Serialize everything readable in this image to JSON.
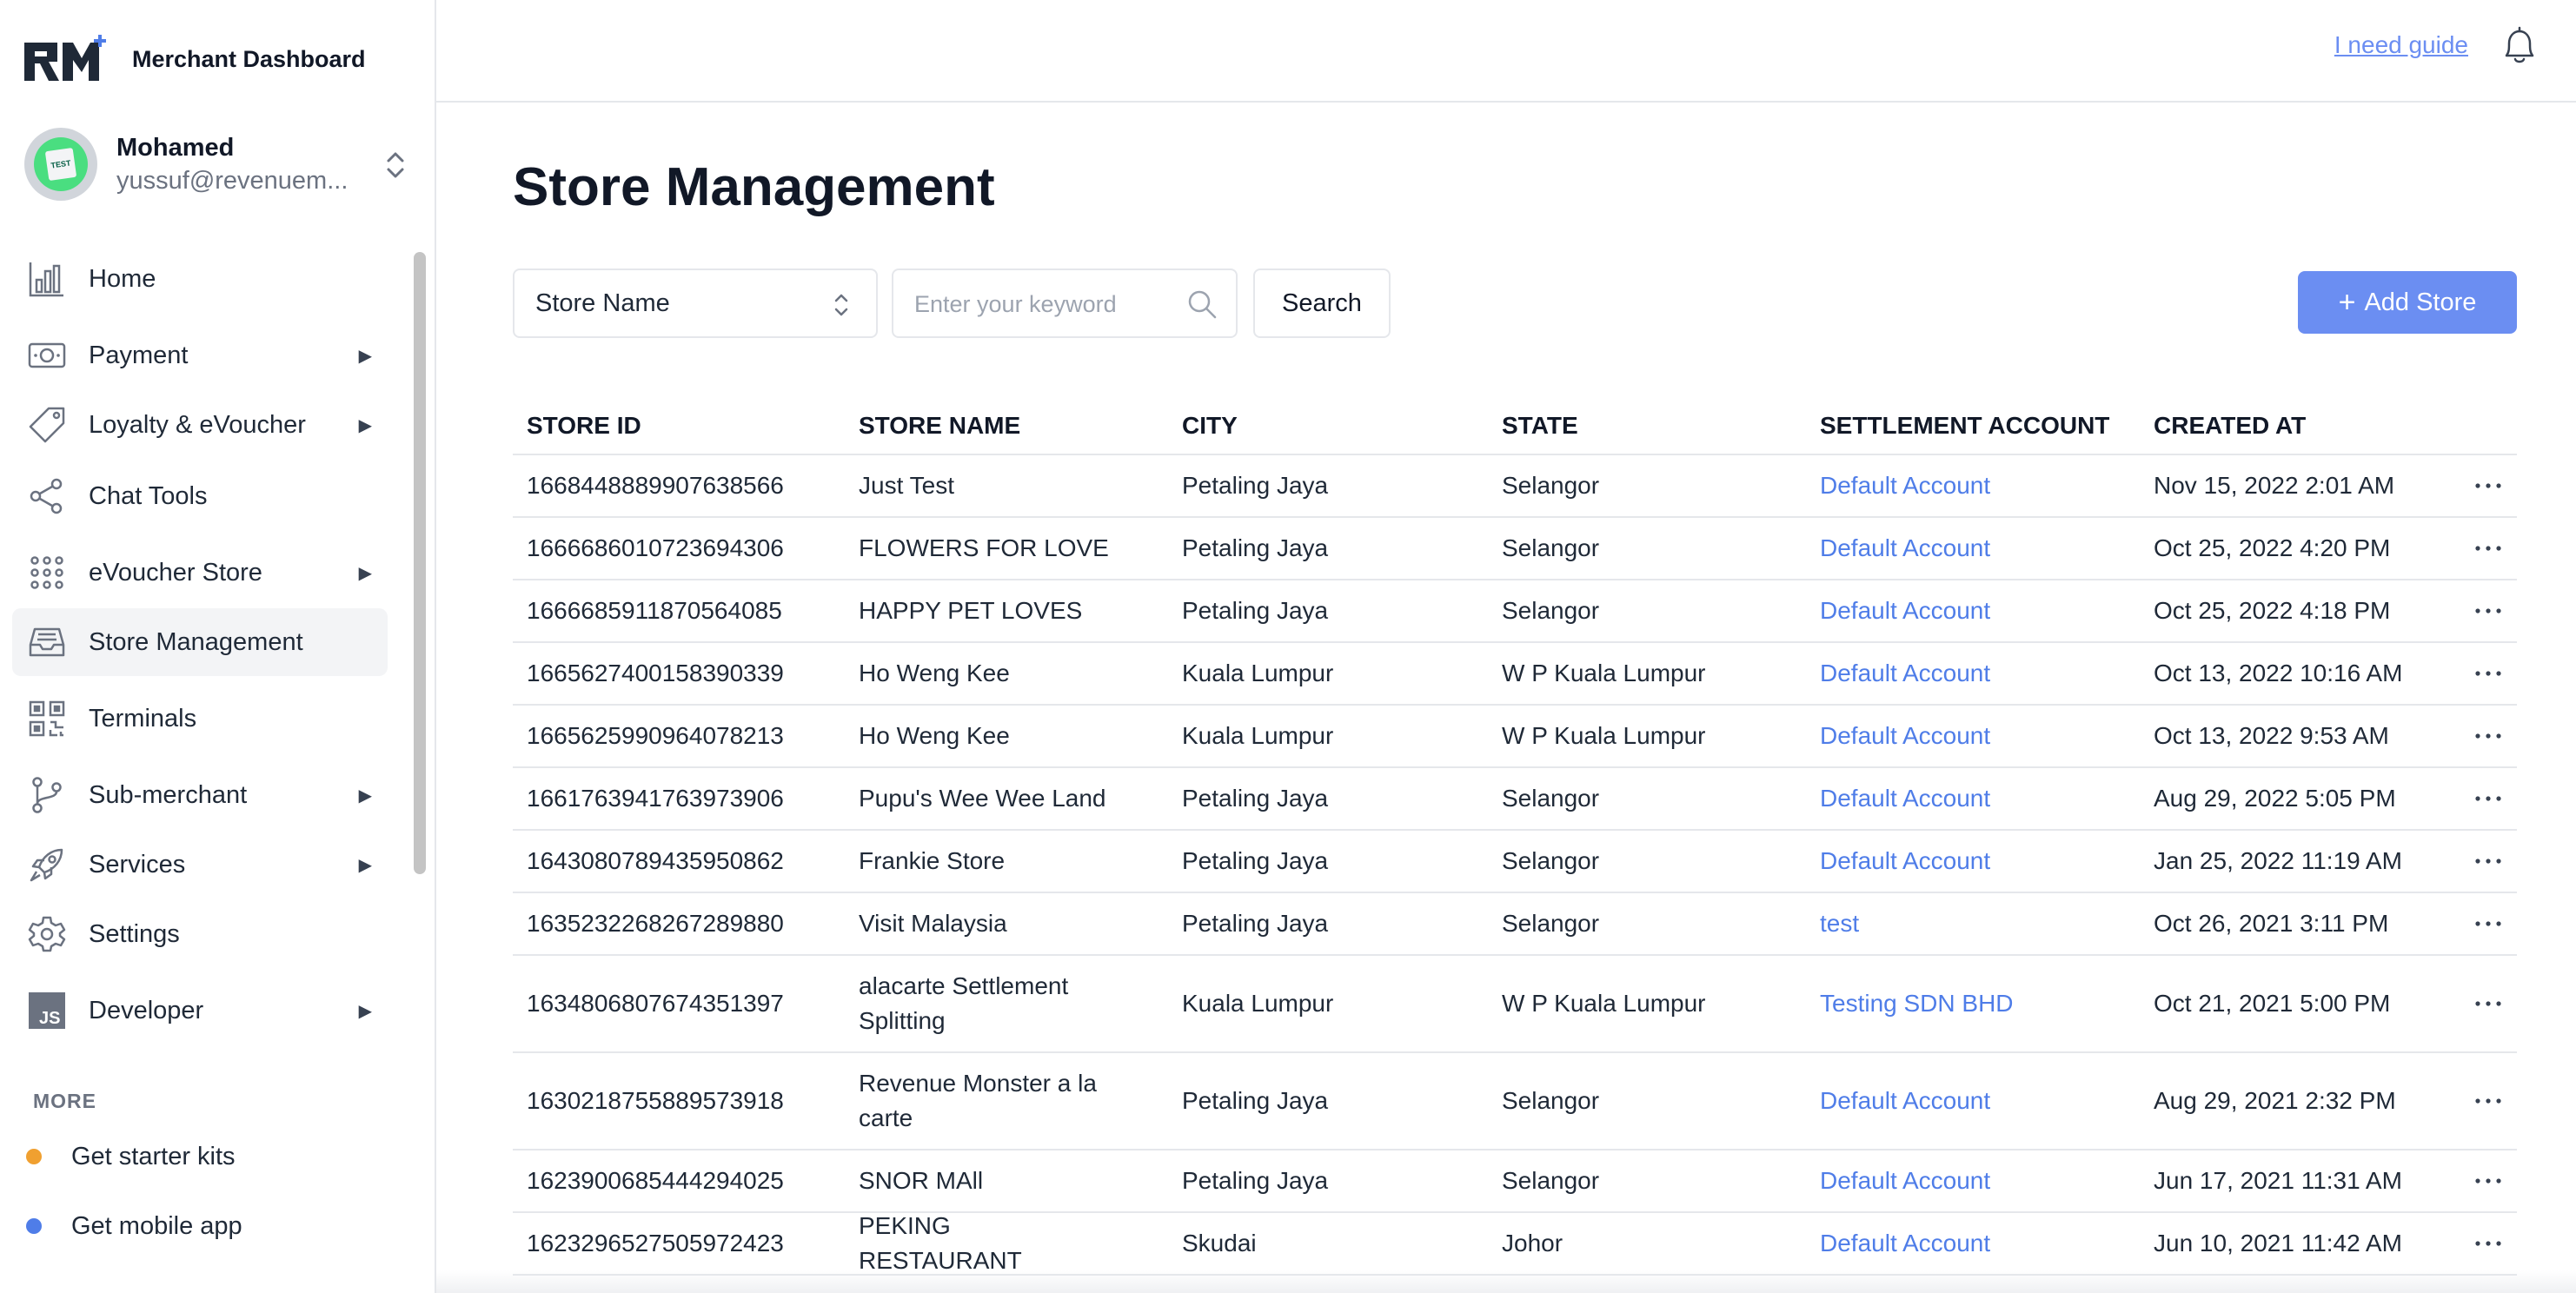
{
  "brand": {
    "title": "Merchant Dashboard",
    "logo_text": "RM"
  },
  "account": {
    "name": "Mohamed",
    "email": "yussuf@revenuem...",
    "avatar_text": "TEST"
  },
  "nav": [
    {
      "label": "Home",
      "icon": "bar-chart-icon",
      "has_submenu": false,
      "active": false
    },
    {
      "label": "Payment",
      "icon": "cash-icon",
      "has_submenu": true,
      "active": false
    },
    {
      "label": "Loyalty & eVoucher",
      "icon": "tag-icon",
      "has_submenu": true,
      "active": false
    },
    {
      "label": "Chat Tools",
      "icon": "share-icon",
      "has_submenu": false,
      "active": false
    },
    {
      "label": "eVoucher Store",
      "icon": "grid-dots-icon",
      "has_submenu": true,
      "active": false
    },
    {
      "label": "Store Management",
      "icon": "inbox-icon",
      "has_submenu": false,
      "active": true
    },
    {
      "label": "Terminals",
      "icon": "qr-code-icon",
      "has_submenu": false,
      "active": false
    },
    {
      "label": "Sub-merchant",
      "icon": "branch-icon",
      "has_submenu": true,
      "active": false
    },
    {
      "label": "Services",
      "icon": "rocket-icon",
      "has_submenu": true,
      "active": false
    },
    {
      "label": "Settings",
      "icon": "gear-icon",
      "has_submenu": false,
      "active": false
    },
    {
      "label": "Developer",
      "icon": "js-icon",
      "has_submenu": true,
      "active": false
    }
  ],
  "more": {
    "title": "MORE",
    "items": [
      {
        "label": "Get starter kits",
        "color": "#f0a030"
      },
      {
        "label": "Get mobile app",
        "color": "#4f7de8"
      }
    ]
  },
  "topbar": {
    "guide_link": "I need guide",
    "icon": "bell-icon"
  },
  "page": {
    "title": "Store Management"
  },
  "filters": {
    "select_value": "Store Name",
    "search_placeholder": "Enter your keyword",
    "search_button": "Search",
    "add_button": "Add Store"
  },
  "colors": {
    "accent": "#6b8ef2",
    "link": "#4f7de8",
    "active_nav_bg": "#f3f4f6"
  },
  "table": {
    "columns": [
      "STORE ID",
      "STORE NAME",
      "CITY",
      "STATE",
      "SETTLEMENT ACCOUNT",
      "CREATED AT"
    ],
    "rows": [
      {
        "id": "1668448889907638566",
        "name": "Just Test",
        "city": "Petaling Jaya",
        "state": "Selangor",
        "settlement": "Default Account",
        "created": "Nov 15, 2022 2:01 AM"
      },
      {
        "id": "1666686010723694306",
        "name": "FLOWERS FOR LOVE",
        "city": "Petaling Jaya",
        "state": "Selangor",
        "settlement": "Default Account",
        "created": "Oct 25, 2022 4:20 PM"
      },
      {
        "id": "1666685911870564085",
        "name": "HAPPY PET LOVES",
        "city": "Petaling Jaya",
        "state": "Selangor",
        "settlement": "Default Account",
        "created": "Oct 25, 2022 4:18 PM"
      },
      {
        "id": "1665627400158390339",
        "name": "Ho Weng Kee",
        "city": "Kuala Lumpur",
        "state": "W P Kuala Lumpur",
        "settlement": "Default Account",
        "created": "Oct 13, 2022 10:16 AM"
      },
      {
        "id": "1665625990964078213",
        "name": "Ho Weng Kee",
        "city": "Kuala Lumpur",
        "state": "W P Kuala Lumpur",
        "settlement": "Default Account",
        "created": "Oct 13, 2022 9:53 AM"
      },
      {
        "id": "1661763941763973906",
        "name": "Pupu's Wee Wee Land",
        "city": "Petaling Jaya",
        "state": "Selangor",
        "settlement": "Default Account",
        "created": "Aug 29, 2022 5:05 PM"
      },
      {
        "id": "1643080789435950862",
        "name": "Frankie Store",
        "city": "Petaling Jaya",
        "state": "Selangor",
        "settlement": "Default Account",
        "created": "Jan 25, 2022 11:19 AM"
      },
      {
        "id": "1635232268267289880",
        "name": "Visit Malaysia",
        "city": "Petaling Jaya",
        "state": "Selangor",
        "settlement": "test",
        "created": "Oct 26, 2021 3:11 PM"
      },
      {
        "id": "1634806807674351397",
        "name": "alacarte Settlement Splitting",
        "city": "Kuala Lumpur",
        "state": "W P Kuala Lumpur",
        "settlement": "Testing SDN BHD",
        "created": "Oct 21, 2021 5:00 PM"
      },
      {
        "id": "1630218755889573918",
        "name": "Revenue Monster a la carte",
        "city": "Petaling Jaya",
        "state": "Selangor",
        "settlement": "Default Account",
        "created": "Aug 29, 2021 2:32 PM"
      },
      {
        "id": "1623900685444294025",
        "name": "SNOR MAll",
        "city": "Petaling Jaya",
        "state": "Selangor",
        "settlement": "Default Account",
        "created": "Jun 17, 2021 11:31 AM"
      },
      {
        "id": "1623296527505972423",
        "name": "PEKING RESTAURANT",
        "city": "Skudai",
        "state": "Johor",
        "settlement": "Default Account",
        "created": "Jun 10, 2021 11:42 AM"
      }
    ]
  }
}
